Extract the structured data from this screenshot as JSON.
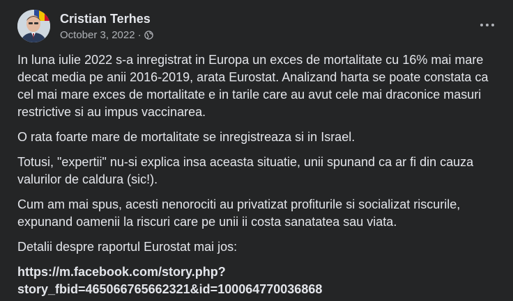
{
  "post": {
    "author": "Cristian Terhes",
    "date": "October 3, 2022",
    "separator": "·",
    "privacy_icon": "globe-icon",
    "more_icon": "more-options-icon",
    "paragraphs": [
      "In luna iulie 2022 s-a inregistrat in Europa un exces de mortalitate cu 16% mai mare decat media pe anii 2016-2019, arata Eurostat. Analizand harta se poate constata ca cel mai mare exces de mortalitate e in tarile care au avut cele mai draconice masuri restrictive si au impus vaccinarea.",
      "O rata foarte mare de mortalitate se inregistreaza si in Israel.",
      "Totusi, \"expertii\" nu-si explica insa aceasta situatie, unii spunand ca ar fi din cauza valurilor de caldura (sic!).",
      "Cum am mai spus, acesti nenorociti au privatizat profiturile si socializat riscurile, expunand oamenii la riscuri care pe unii ii costa sanatatea sau viata.",
      "Detalii despre raportul Eurostat mai jos:"
    ],
    "link_line1": "https://m.facebook.com/story.php?",
    "link_line2": "story_fbid=465066765662321&id=100064770036868"
  },
  "colors": {
    "background": "#242526",
    "text": "#e4e6eb",
    "secondary_text": "#b0b3b8"
  }
}
